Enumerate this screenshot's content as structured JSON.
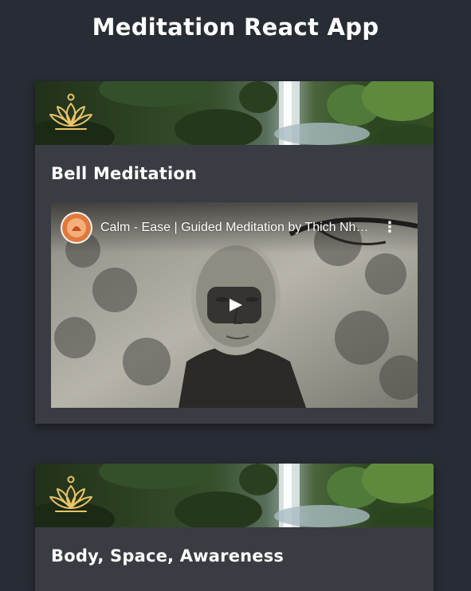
{
  "app": {
    "title": "Meditation React App"
  },
  "cards": [
    {
      "title": "Bell Meditation",
      "banner_icon": "lotus-icon",
      "video": {
        "title": "Calm - Ease | Guided Meditation by Thich Nhat Hanh",
        "channel_icon": "channel-avatar-icon",
        "menu_icon": "kebab-menu-icon",
        "play_icon": "play-icon"
      }
    },
    {
      "title": "Body, Space, Awareness",
      "banner_icon": "lotus-icon"
    }
  ],
  "colors": {
    "background": "#282c34",
    "card": "#393c42",
    "accent_gold": "#e9c46a",
    "text": "#ffffff"
  }
}
